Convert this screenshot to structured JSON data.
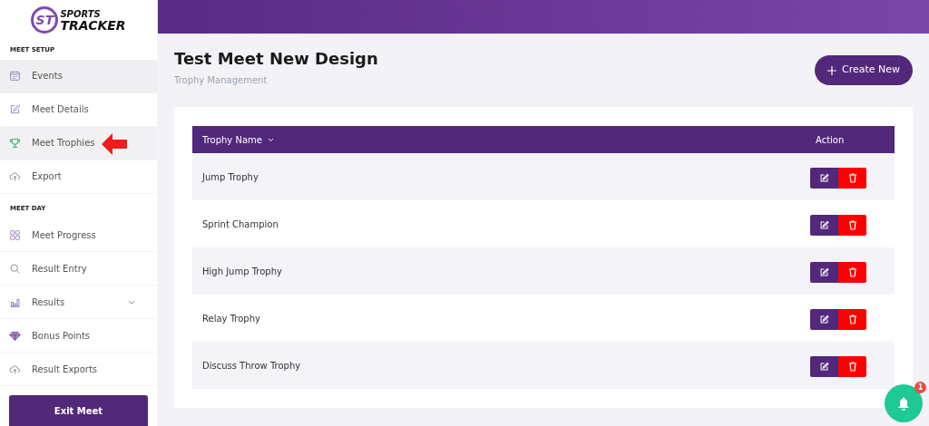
{
  "logo": {
    "mark": "ST",
    "line_1": "SPORTS",
    "line_2": "TRACKER"
  },
  "sidebar": {
    "sections": [
      {
        "heading": "MEET SETUP",
        "items": [
          {
            "label": "Events",
            "selected": false,
            "hovered": true
          },
          {
            "label": "Meet Details",
            "selected": false
          },
          {
            "label": "Meet Trophies",
            "selected": true
          },
          {
            "label": "Export",
            "selected": false
          }
        ]
      },
      {
        "heading": "MEET DAY",
        "items": [
          {
            "label": "Meet Progress",
            "selected": false
          },
          {
            "label": "Result Entry",
            "selected": false
          },
          {
            "label": "Results",
            "selected": false,
            "expandable": true
          },
          {
            "label": "Bonus Points",
            "selected": false
          },
          {
            "label": "Result Exports",
            "selected": false
          }
        ]
      }
    ],
    "exit_button": "Exit Meet"
  },
  "page": {
    "title": "Test Meet New Design",
    "subtitle": "Trophy Management",
    "create_button": "Create New"
  },
  "table": {
    "columns": [
      "Trophy Name",
      "Action"
    ],
    "rows": [
      {
        "name": "Jump Trophy"
      },
      {
        "name": "Sprint Champion"
      },
      {
        "name": "High Jump Trophy"
      },
      {
        "name": "Relay Trophy"
      },
      {
        "name": "Discuss Throw Trophy"
      }
    ]
  },
  "notifications": {
    "count": "1"
  }
}
